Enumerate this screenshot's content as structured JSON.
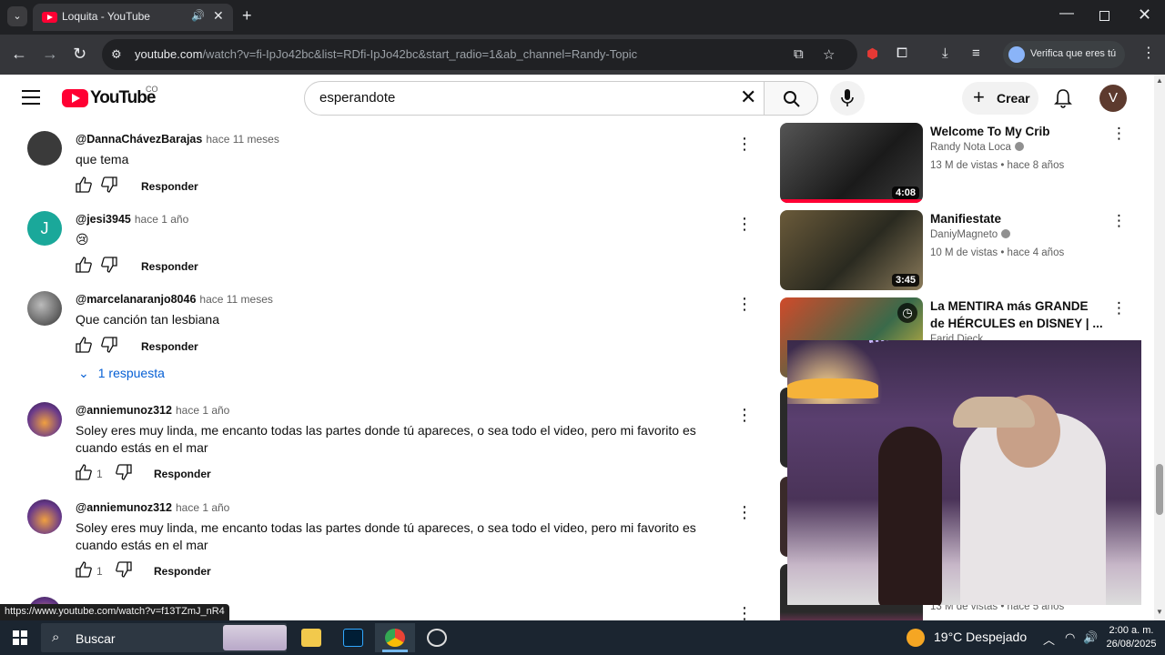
{
  "browser": {
    "tab_title": "Loquita - YouTube",
    "url_host": "youtube.com",
    "url_path": "/watch?v=fi-IpJo42bc&list=RDfi-IpJo42bc&start_radio=1&ab_channel=Randy-Topic",
    "verify_label": "Verifica que eres tú"
  },
  "youtube": {
    "logo_text": "YouTube",
    "country": "CO",
    "search_value": "esperandote",
    "create_label": "Crear",
    "avatar_letter": "V"
  },
  "comments": [
    {
      "author": "@DannaChávezBarajas",
      "time": "hace 11 meses",
      "text": "que tema",
      "likes": "",
      "reply": "Responder",
      "avatar_color": "#3a3a3a"
    },
    {
      "author": "@jesi3945",
      "time": "hace 1 año",
      "text": "😢",
      "likes": "",
      "reply": "Responder",
      "avatar_color": "#1aa89a",
      "avatar_letter": "J"
    },
    {
      "author": "@marcelanaranjo8046",
      "time": "hace 11 meses",
      "text": "Que canción tan lesbiana",
      "likes": "",
      "reply": "Responder",
      "avatar_color": "#4a4a4a"
    },
    {
      "author": "@anniemunoz312",
      "time": "hace 1 año",
      "text": "Soley eres muy linda, me encanto todas las partes donde tú apareces, o sea todo el video, pero mi favorito es cuando estás en el mar",
      "likes": "1",
      "reply": "Responder",
      "avatar_color": "#6a3a8a"
    },
    {
      "author": "@anniemunoz312",
      "time": "hace 1 año",
      "text": "Soley eres muy linda, me encanto todas las partes donde tú apareces, o sea todo el video, pero mi favorito es cuando estás en el mar",
      "likes": "1",
      "reply": "Responder",
      "avatar_color": "#6a3a8a"
    }
  ],
  "replies_toggle": "1 respuesta",
  "sidebar_videos": [
    {
      "title": "Welcome To My Crib",
      "channel": "Randy Nota Loca",
      "meta": "13 M de vistas • hace 8 años",
      "duration": "4:08",
      "thumb_color": "#2a2a2a"
    },
    {
      "title": "Manifiestate",
      "channel": "DaniyMagneto",
      "meta": "10 M de vistas • hace 4 años",
      "duration": "3:45",
      "thumb_color": "#3a3a2a"
    },
    {
      "title": "La MENTIRA más GRANDE de HÉRCULES en DISNEY | ...",
      "channel": "Farid Dieck",
      "meta": "",
      "duration": "",
      "thumb_color": "#c04030"
    }
  ],
  "sidebar_partial_meta": "13 M de vistas • hace 5 años",
  "status_link": "https://www.youtube.com/watch?v=f13TZmJ_nR4",
  "taskbar": {
    "search_label": "Buscar",
    "weather": "19°C  Despejado",
    "time": "2:00 a. m.",
    "date": "26/08/2025"
  },
  "colors": {
    "youtube_red": "#ff0033",
    "link_blue": "#065fd4",
    "chrome_dark": "#202124"
  }
}
